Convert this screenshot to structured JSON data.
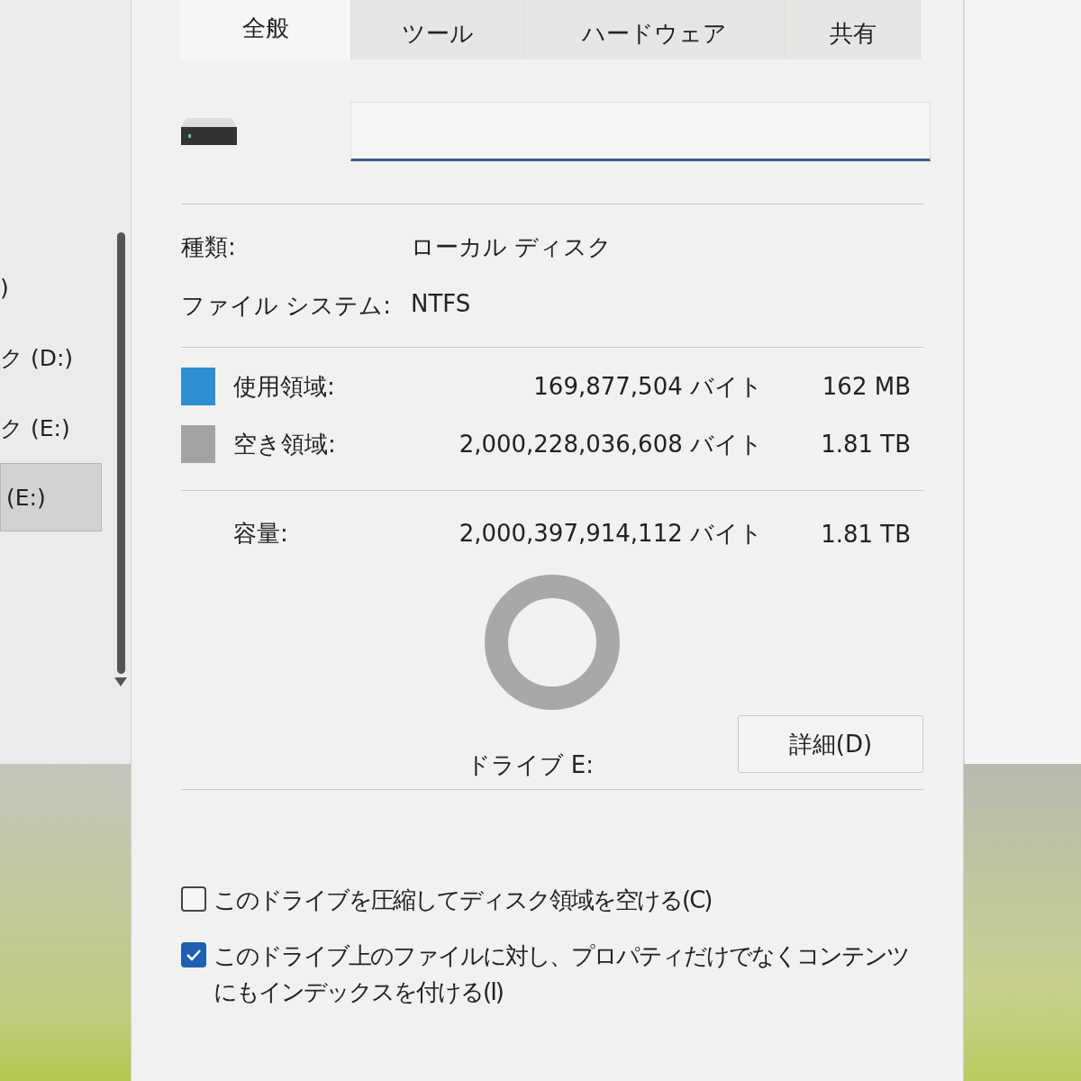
{
  "nav": {
    "items": [
      {
        "label": ")",
        "selected": false
      },
      {
        "label": "ク (D:)",
        "selected": false
      },
      {
        "label": "ク (E:)",
        "selected": false
      },
      {
        "label": "(E:)",
        "selected": true
      }
    ]
  },
  "dialog": {
    "tabs": [
      {
        "label": "全般",
        "selected": true
      },
      {
        "label": "ツール",
        "selected": false
      },
      {
        "label": "ハードウェア",
        "selected": false
      },
      {
        "label": "共有",
        "selected": false
      }
    ],
    "info": [
      {
        "label": "種類:",
        "value": "ローカル ディスク"
      },
      {
        "label": "ファイル システム:",
        "value": "NTFS"
      }
    ],
    "usage": [
      {
        "label": "使用領域:",
        "bytes": "169,877,504 バイト",
        "size": "162 MB",
        "color": "#2f8fd0"
      },
      {
        "label": "空き領域:",
        "bytes": "2,000,228,036,608 バイト",
        "size": "1.81 TB",
        "color": "#a3a3a3"
      }
    ],
    "capacity": {
      "label": "容量:",
      "bytes": "2,000,397,914,112 バイト",
      "size": "1.81 TB"
    },
    "drive_label": "ドライブ E:",
    "details_button": "詳細(D)",
    "options": [
      {
        "label": "このドライブを圧縮してディスク領域を空ける(C)",
        "checked": false
      },
      {
        "label": "このドライブ上のファイルに対し、プロパティだけでなくコンテンツにもインデックスを付ける(I)",
        "checked": true
      }
    ]
  }
}
